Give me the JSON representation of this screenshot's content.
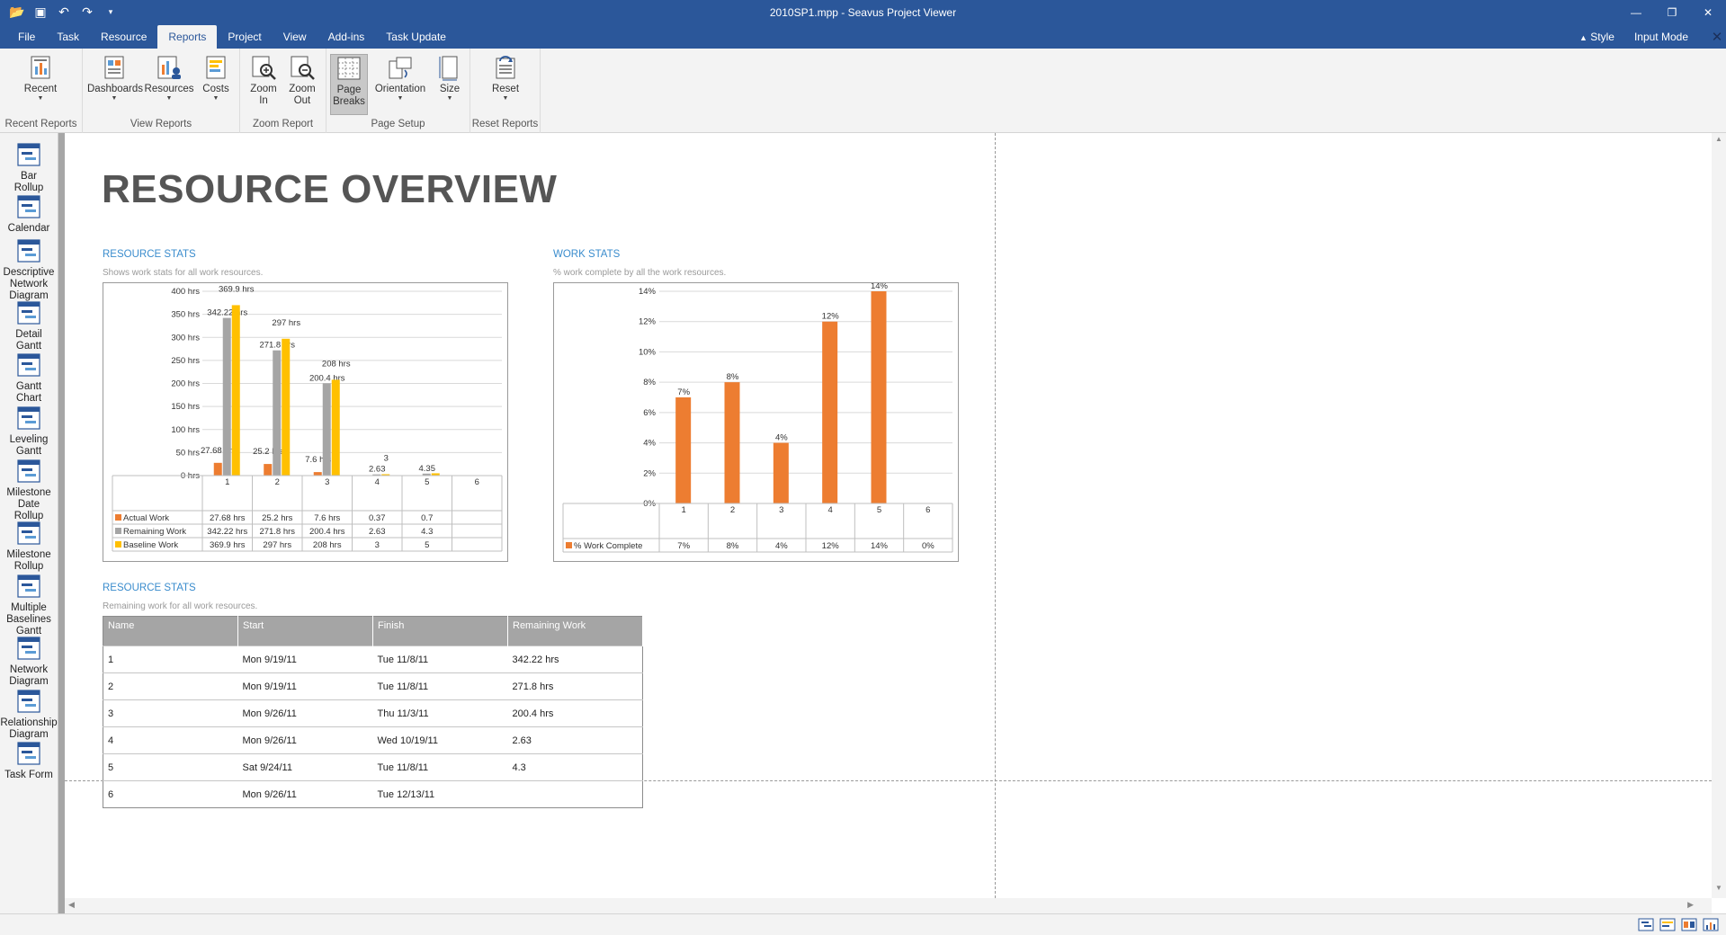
{
  "window": {
    "title": "2010SP1.mpp - Seavus Project Viewer"
  },
  "menu": {
    "tabs": [
      "File",
      "Task",
      "Resource",
      "Reports",
      "Project",
      "View",
      "Add-ins",
      "Task Update"
    ],
    "active_tab": "Reports",
    "style_label": "Style",
    "input_mode_label": "Input Mode"
  },
  "ribbon": {
    "groups": {
      "recent_reports": "Recent Reports",
      "view_reports": "View Reports",
      "zoom_report": "Zoom Report",
      "page_setup": "Page Setup",
      "reset_reports": "Reset Reports"
    },
    "buttons": {
      "recent": "Recent",
      "dashboards": "Dashboards",
      "resources": "Resources",
      "costs": "Costs",
      "zoom_in_1": "Zoom",
      "zoom_in_2": "In",
      "zoom_out_1": "Zoom",
      "zoom_out_2": "Out",
      "page_breaks_1": "Page",
      "page_breaks_2": "Breaks",
      "orientation": "Orientation",
      "size": "Size",
      "reset": "Reset"
    }
  },
  "sidebar": {
    "items": [
      [
        "Bar",
        "Rollup"
      ],
      [
        "Calendar"
      ],
      [
        "Descriptive",
        "Network",
        "Diagram"
      ],
      [
        "Detail",
        "Gantt"
      ],
      [
        "Gantt",
        "Chart"
      ],
      [
        "Leveling",
        "Gantt"
      ],
      [
        "Milestone",
        "Date",
        "Rollup"
      ],
      [
        "Milestone",
        "Rollup"
      ],
      [
        "Multiple",
        "Baselines",
        "Gantt"
      ],
      [
        "Network",
        "Diagram"
      ],
      [
        "Relationship",
        "Diagram"
      ],
      [
        "Task Form"
      ]
    ]
  },
  "report": {
    "title": "RESOURCE OVERVIEW",
    "resource_stats_title": "RESOURCE STATS",
    "resource_stats_sub": "Shows work stats for all work resources.",
    "work_stats_title": "WORK STATS",
    "work_stats_sub": "% work complete by all the work resources.",
    "table_title": "RESOURCE STATS",
    "table_sub": "Remaining work for all work resources.",
    "table": {
      "headers": [
        "Name",
        "Start",
        "Finish",
        "Remaining Work"
      ],
      "rows": [
        [
          "1",
          "Mon 9/19/11",
          "Tue 11/8/11",
          "342.22 hrs"
        ],
        [
          "2",
          "Mon 9/19/11",
          "Tue 11/8/11",
          "271.8 hrs"
        ],
        [
          "3",
          "Mon 9/26/11",
          "Thu 11/3/11",
          "200.4 hrs"
        ],
        [
          "4",
          "Mon 9/26/11",
          "Wed 10/19/11",
          "2.63"
        ],
        [
          "5",
          "Sat 9/24/11",
          "Tue 11/8/11",
          "4.3"
        ],
        [
          "6",
          "Mon 9/26/11",
          "Tue 12/13/11",
          ""
        ]
      ]
    }
  },
  "chart_data": [
    {
      "type": "bar",
      "categories": [
        "1",
        "2",
        "3",
        "4",
        "5",
        "6"
      ],
      "ylim": [
        0,
        400
      ],
      "yticks": [
        "0 hrs",
        "50 hrs",
        "100 hrs",
        "150 hrs",
        "200 hrs",
        "250 hrs",
        "300 hrs",
        "350 hrs",
        "400 hrs"
      ],
      "legend": "table-below",
      "grid": true,
      "series": [
        {
          "name": "Actual Work",
          "color": "#ed7d31",
          "values": [
            27.68,
            25.2,
            7.6,
            0.37,
            0.7,
            0
          ],
          "table_labels": [
            "27.68 hrs",
            "25.2 hrs",
            "7.6 hrs",
            "0.37",
            "0.7",
            ""
          ],
          "bar_labels": [
            "27.68 hrs",
            "25.2 hrs",
            "7.6 hrs",
            "",
            "",
            ""
          ]
        },
        {
          "name": "Remaining Work",
          "color": "#a5a5a5",
          "values": [
            342.22,
            271.8,
            200.4,
            2.63,
            4.3,
            0
          ],
          "table_labels": [
            "342.22 hrs",
            "271.8 hrs",
            "200.4 hrs",
            "2.63",
            "4.3",
            ""
          ],
          "bar_labels": [
            "342.22 hrs",
            "271.8 hrs",
            "200.4 hrs",
            "2.63",
            "4.35",
            ""
          ]
        },
        {
          "name": "Baseline Work",
          "color": "#ffc000",
          "values": [
            369.9,
            297,
            208,
            3,
            5,
            0
          ],
          "table_labels": [
            "369.9 hrs",
            "297 hrs",
            "208 hrs",
            "3",
            "5",
            ""
          ],
          "bar_labels": [
            "369.9 hrs",
            "297 hrs",
            "208 hrs",
            "3",
            "",
            ""
          ]
        }
      ]
    },
    {
      "type": "bar",
      "categories": [
        "1",
        "2",
        "3",
        "4",
        "5",
        "6"
      ],
      "ylim": [
        0,
        14
      ],
      "yticks": [
        "0%",
        "2%",
        "4%",
        "6%",
        "8%",
        "10%",
        "12%",
        "14%"
      ],
      "legend": "table-below",
      "grid": true,
      "series": [
        {
          "name": "% Work Complete",
          "color": "#ed7d31",
          "values": [
            7,
            8,
            4,
            12,
            14,
            0
          ],
          "table_labels": [
            "7%",
            "8%",
            "4%",
            "12%",
            "14%",
            "0%"
          ],
          "bar_labels": [
            "7%",
            "8%",
            "4%",
            "12%",
            "14%",
            ""
          ]
        }
      ]
    }
  ]
}
